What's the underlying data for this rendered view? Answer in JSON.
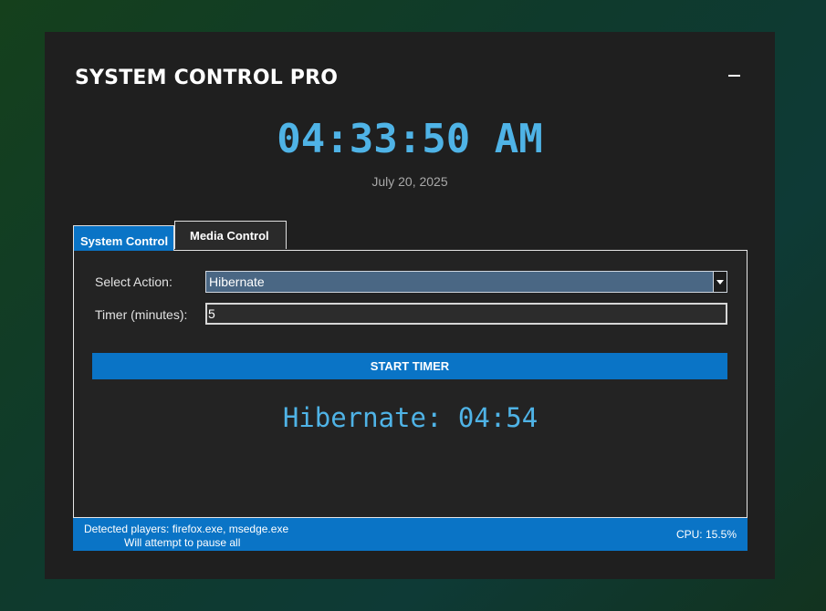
{
  "app": {
    "title": "SYSTEM CONTROL PRO",
    "minimize_icon": "minimize-icon"
  },
  "clock": {
    "time": "04:33:50 AM",
    "date": "July 20, 2025"
  },
  "tabs": [
    {
      "label": "System Control",
      "active": true
    },
    {
      "label": "Media Control",
      "active": false
    }
  ],
  "form": {
    "action_label": "Select Action:",
    "action_value": "Hibernate",
    "timer_label": "Timer (minutes):",
    "timer_value": "5",
    "start_label": "START TIMER"
  },
  "countdown": {
    "text": "Hibernate: 04:54"
  },
  "status": {
    "players_line": "Detected players: firefox.exe, msedge.exe",
    "pause_line": "Will attempt to pause all",
    "cpu": "CPU: 15.5%"
  },
  "colors": {
    "accent": "#0a74c6",
    "clock": "#4fb3e6",
    "window_bg": "#1f1f1f"
  }
}
